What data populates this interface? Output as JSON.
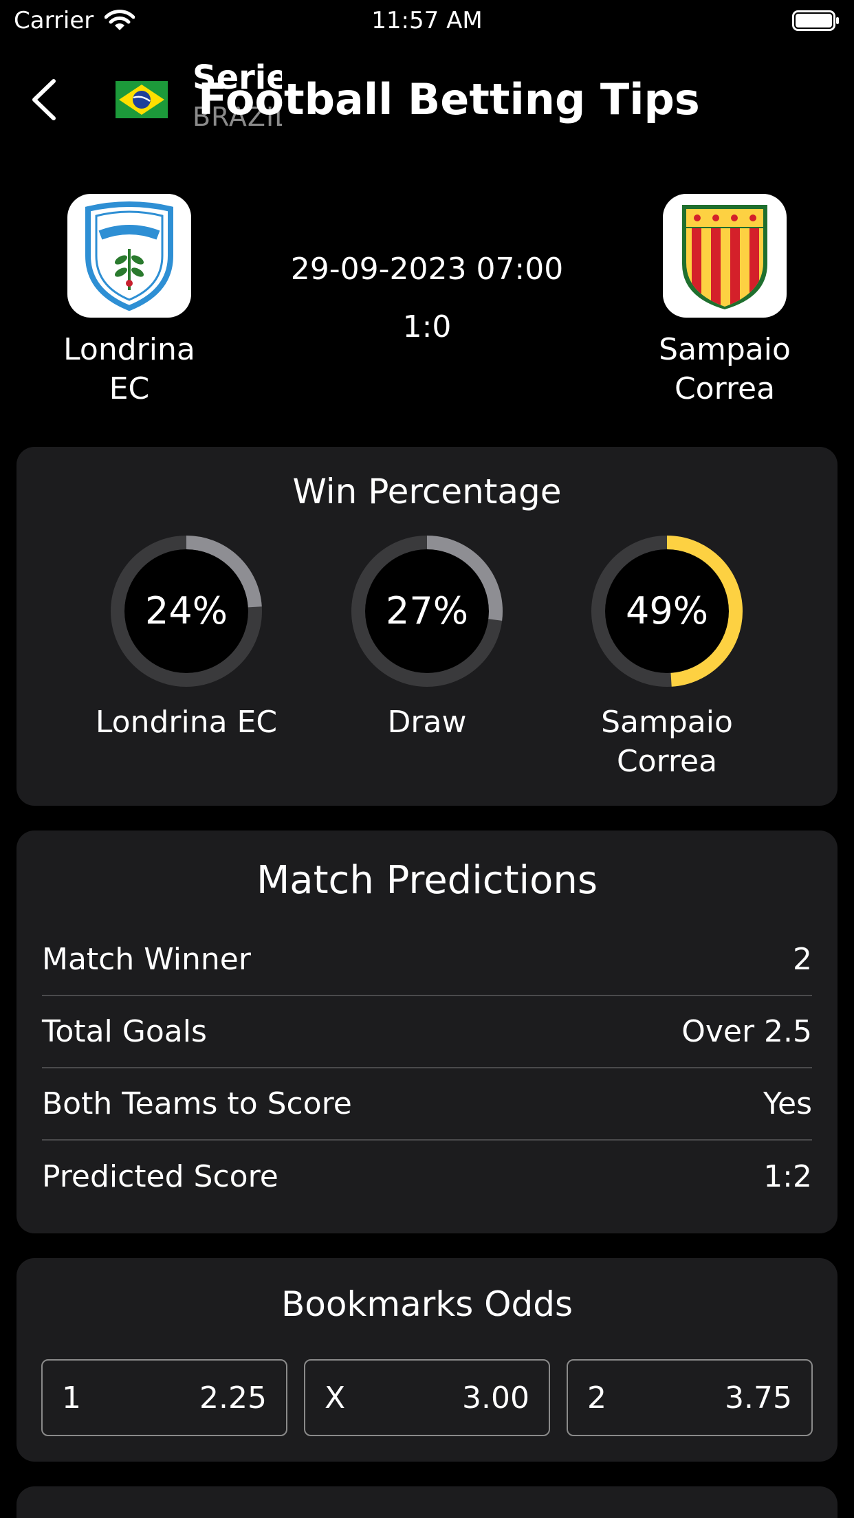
{
  "status_bar": {
    "carrier": "Carrier",
    "time": "11:57 AM"
  },
  "nav": {
    "title": "Football Betting Tips",
    "league_name": "Serie B",
    "league_country": "BRAZIL",
    "back_icon": "chevron-left-icon",
    "flag_icon": "brazil-flag-icon"
  },
  "match": {
    "home_team": "Londrina EC",
    "away_team": "Sampaio Correa",
    "date_time": "29-09-2023 07:00",
    "score": "1:0"
  },
  "win_percentage": {
    "title": "Win Percentage",
    "items": [
      {
        "label": "Londrina EC",
        "value_text": "24%",
        "value": 24,
        "color": "#8e8e93"
      },
      {
        "label": "Draw",
        "value_text": "27%",
        "value": 27,
        "color": "#8e8e93"
      },
      {
        "label": "Sampaio Correa",
        "value_text": "49%",
        "value": 49,
        "color": "#fdd142"
      }
    ],
    "track_color": "#3a3a3c"
  },
  "predictions": {
    "title": "Match Predictions",
    "rows": [
      {
        "label": "Match Winner",
        "value": "2"
      },
      {
        "label": "Total Goals",
        "value": "Over 2.5"
      },
      {
        "label": "Both Teams to Score",
        "value": "Yes"
      },
      {
        "label": "Predicted Score",
        "value": "1:2"
      }
    ]
  },
  "odds": {
    "title": "Bookmarks Odds",
    "items": [
      {
        "outcome": "1",
        "odd": "2.25"
      },
      {
        "outcome": "X",
        "odd": "3.00"
      },
      {
        "outcome": "2",
        "odd": "3.75"
      }
    ]
  },
  "colors": {
    "background": "#000000",
    "card": "#1c1c1e",
    "accent": "#fdd142"
  }
}
